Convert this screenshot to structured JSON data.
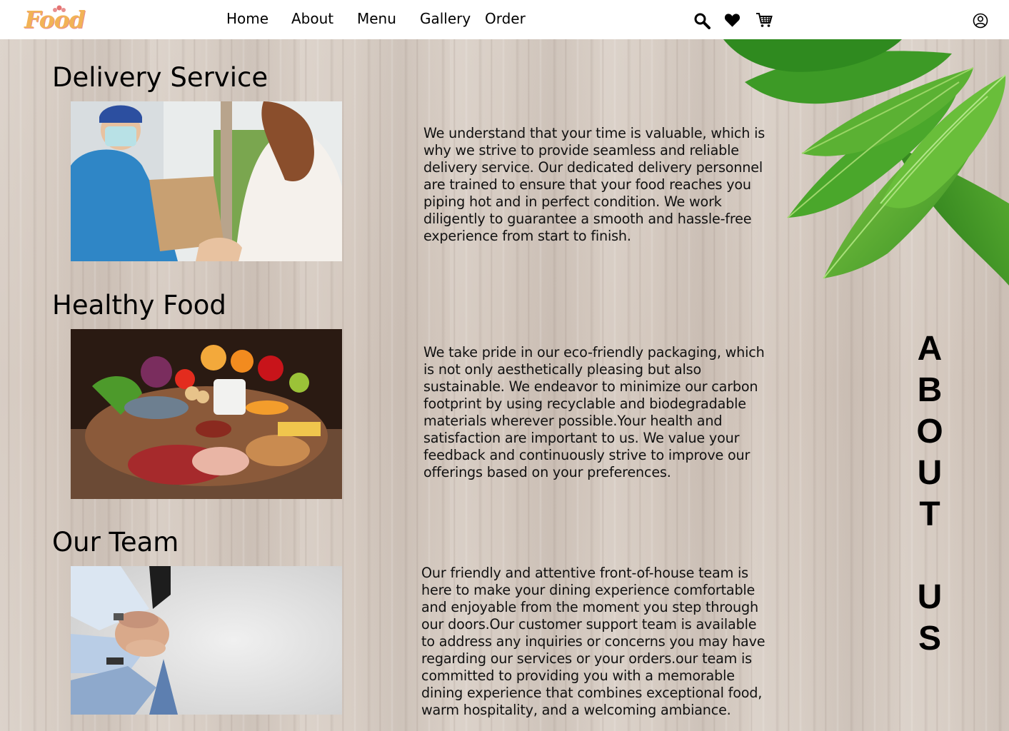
{
  "brand": {
    "logo_text": "Food"
  },
  "nav": {
    "items": [
      {
        "label": "Home"
      },
      {
        "label": "About"
      },
      {
        "label": "Menu"
      },
      {
        "label": "Gallery"
      },
      {
        "label": "Order"
      }
    ]
  },
  "header_icons": [
    "search-icon",
    "heart-icon",
    "cart-icon",
    "user-account-icon"
  ],
  "colors": {
    "logo": "#f2b356",
    "logo_accent": "#e88f8f",
    "text": "#000000",
    "wood_background": "#d6cbc1"
  },
  "sections": [
    {
      "title": "Delivery Service",
      "image": "delivery-person-handing-bag",
      "text": "We understand that your time is valuable, which is why we strive to provide seamless and reliable delivery service. Our dedicated delivery personnel are trained to ensure that your food reaches you piping hot and in perfect condition. We work diligently to guarantee a smooth and hassle-free experience from start to finish."
    },
    {
      "title": "Healthy Food",
      "image": "fresh-groceries-assortment",
      "text": "We take pride in our eco-friendly packaging, which is not only aesthetically pleasing but also sustainable. We endeavor to minimize our carbon footprint by using recyclable and biodegradable materials wherever possible.Your health and satisfaction are important to us. We value your feedback and continuously strive to improve our offerings based on your preferences."
    },
    {
      "title": "Our Team",
      "image": "team-hands-stacked",
      "text": " Our friendly and attentive front-of-house team is here to make your dining experience comfortable and enjoyable from the moment you step through our doors.Our customer support team is available to address any inquiries or concerns you may have regarding our services or your orders.our team is committed to providing you with a memorable dining experience that combines exceptional food, warm hospitality, and a welcoming ambiance."
    }
  ],
  "side_heading": {
    "letters": [
      "A",
      "B",
      "O",
      "U",
      "T",
      "",
      "U",
      "S"
    ]
  }
}
